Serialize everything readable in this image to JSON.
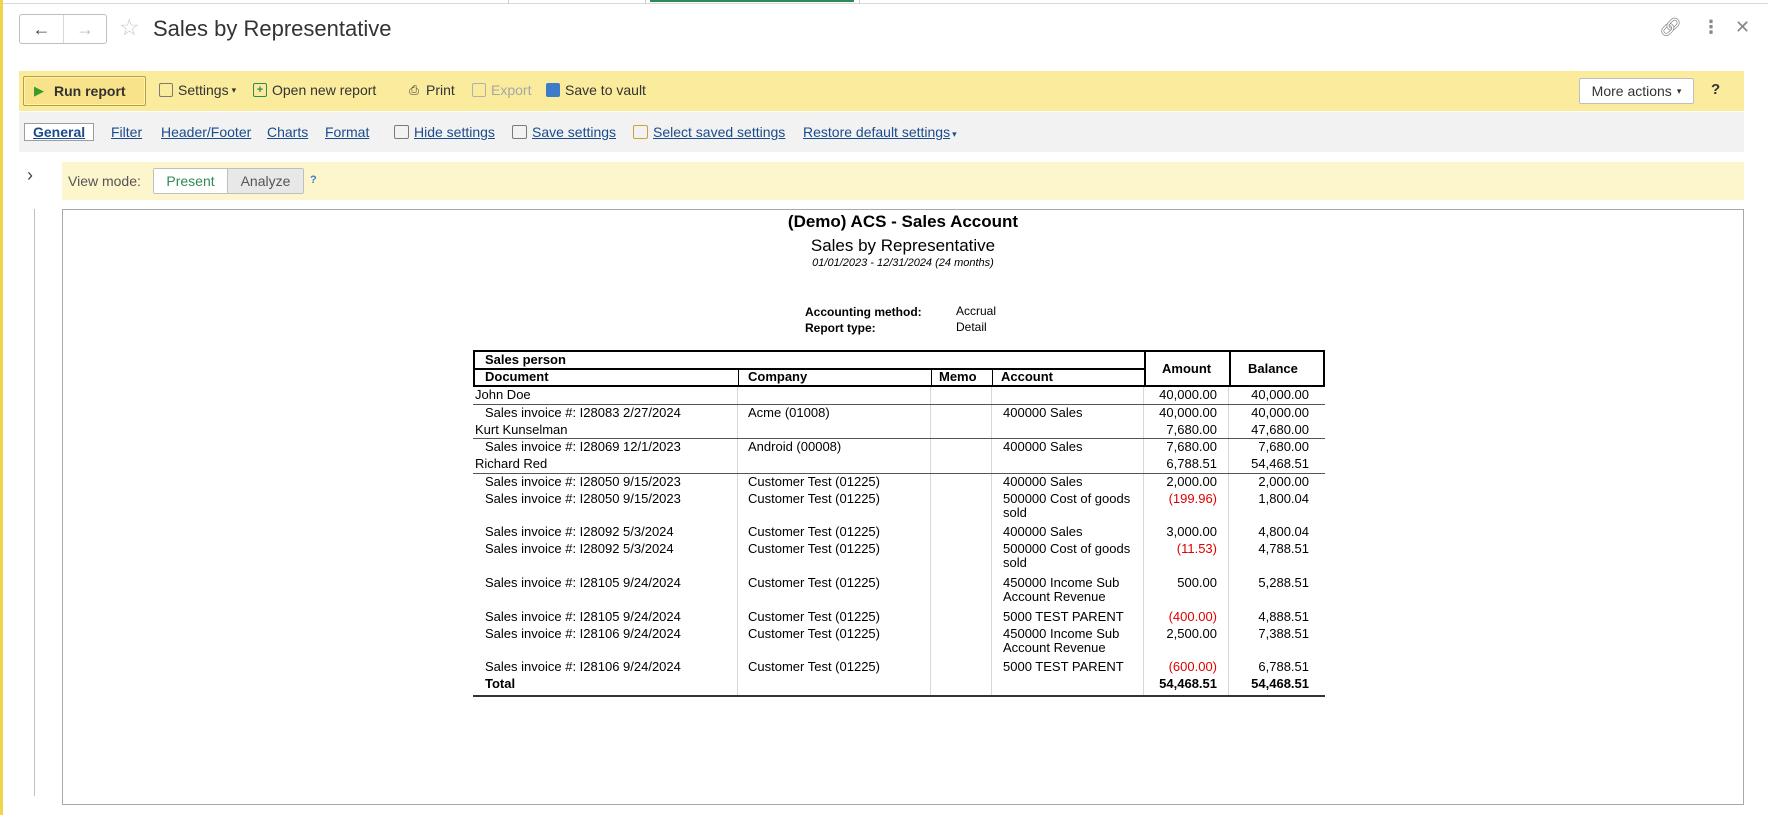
{
  "window": {
    "title": "Sales by Representative"
  },
  "toolbar": {
    "run_label": "Run report",
    "settings_label": "Settings",
    "open_new_label": "Open new report",
    "print_label": "Print",
    "export_label": "Export",
    "save_vault_label": "Save to vault",
    "more_actions_label": "More actions",
    "help_label": "?"
  },
  "settings_tabs": {
    "general": "General",
    "filter": "Filter",
    "header_footer": "Header/Footer",
    "charts": "Charts",
    "format": "Format",
    "hide_settings": "Hide settings",
    "save_settings": "Save settings",
    "select_saved": "Select saved settings",
    "restore_default": "Restore default settings"
  },
  "view_mode": {
    "label": "View mode:",
    "present": "Present",
    "analyze": "Analyze",
    "help": "?"
  },
  "report": {
    "company": "(Demo) ACS - Sales Account",
    "title": "Sales by Representative",
    "period": "01/01/2023 - 12/31/2024 (24 months)",
    "accounting_method_label": "Accounting method:",
    "accounting_method_value": "Accrual",
    "report_type_label": "Report type:",
    "report_type_value": "Detail",
    "headers": {
      "sales_person": "Sales person",
      "document": "Document",
      "company": "Company",
      "memo": "Memo",
      "account": "Account",
      "amount": "Amount",
      "balance": "Balance"
    },
    "rows": [
      {
        "document": "John Doe",
        "company": "",
        "account": "",
        "account2": "",
        "amount": "40,000.00",
        "balance": "40,000.00"
      },
      {
        "document": "Sales invoice #: I28083 2/27/2024",
        "company": "Acme (01008)",
        "account": "400000 Sales",
        "account2": "",
        "amount": "40,000.00",
        "balance": "40,000.00"
      },
      {
        "document": "Kurt Kunselman",
        "company": "",
        "account": "",
        "account2": "",
        "amount": "7,680.00",
        "balance": "47,680.00"
      },
      {
        "document": "Sales invoice #: I28069 12/1/2023",
        "company": "Android (00008)",
        "account": "400000 Sales",
        "account2": "",
        "amount": "7,680.00",
        "balance": "7,680.00"
      },
      {
        "document": "Richard Red",
        "company": "",
        "account": "",
        "account2": "",
        "amount": "6,788.51",
        "balance": "54,468.51"
      },
      {
        "document": "Sales invoice #: I28050 9/15/2023",
        "company": "Customer Test (01225)",
        "account": "400000 Sales",
        "account2": "",
        "amount": "2,000.00",
        "balance": "2,000.00"
      },
      {
        "document": "Sales invoice #: I28050 9/15/2023",
        "company": "Customer Test (01225)",
        "account": "500000 Cost of goods",
        "account2": "sold",
        "amount": "(199.96)",
        "balance": "1,800.04"
      },
      {
        "document": "Sales invoice #: I28092 5/3/2024",
        "company": "Customer Test (01225)",
        "account": "400000 Sales",
        "account2": "",
        "amount": "3,000.00",
        "balance": "4,800.04"
      },
      {
        "document": "Sales invoice #: I28092 5/3/2024",
        "company": "Customer Test (01225)",
        "account": "500000 Cost of goods",
        "account2": "sold",
        "amount": "(11.53)",
        "balance": "4,788.51"
      },
      {
        "document": "Sales invoice #: I28105 9/24/2024",
        "company": "Customer Test (01225)",
        "account": "450000 Income Sub",
        "account2": "Account Revenue",
        "amount": "500.00",
        "balance": "5,288.51"
      },
      {
        "document": "Sales invoice #: I28105 9/24/2024",
        "company": "Customer Test (01225)",
        "account": "5000 TEST PARENT",
        "account2": "",
        "amount": "(400.00)",
        "balance": "4,888.51"
      },
      {
        "document": "Sales invoice #: I28106 9/24/2024",
        "company": "Customer Test (01225)",
        "account": "450000 Income Sub",
        "account2": "Account Revenue",
        "amount": "2,500.00",
        "balance": "7,388.51"
      },
      {
        "document": "Sales invoice #: I28106 9/24/2024",
        "company": "Customer Test (01225)",
        "account": "5000 TEST PARENT",
        "account2": "",
        "amount": "(600.00)",
        "balance": "6,788.51"
      }
    ],
    "total": {
      "label": "Total",
      "amount": "54,468.51",
      "balance": "54,468.51"
    }
  },
  "colors": {
    "toolbar_bg": "#faeb9d",
    "accent_green": "#2e8b57",
    "link_blue": "#1a4c8c",
    "negative_red": "#e00000"
  }
}
